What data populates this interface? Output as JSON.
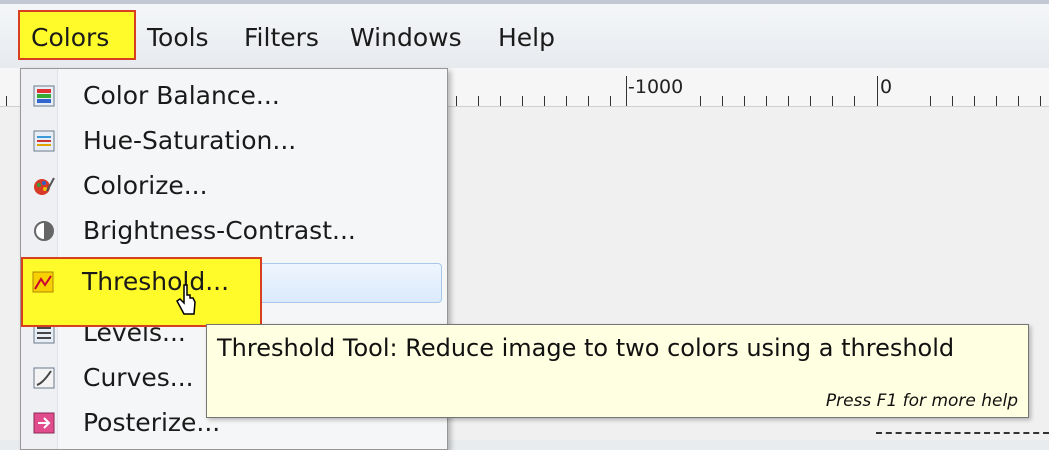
{
  "menubar": {
    "items": [
      {
        "label": "Colors"
      },
      {
        "label": "Tools"
      },
      {
        "label": "Filters"
      },
      {
        "label": "Windows"
      },
      {
        "label": "Help"
      }
    ]
  },
  "ruler": {
    "labels": [
      "-1000",
      "0"
    ]
  },
  "menu": {
    "items": [
      {
        "label": "Color Balance...",
        "icon": "color-balance-icon"
      },
      {
        "label": "Hue-Saturation...",
        "icon": "hue-saturation-icon"
      },
      {
        "label": "Colorize...",
        "icon": "colorize-icon"
      },
      {
        "label": "Brightness-Contrast...",
        "icon": "brightness-contrast-icon"
      },
      {
        "label": "Threshold...",
        "icon": "threshold-icon",
        "highlighted": true
      },
      {
        "label": "Levels...",
        "icon": "levels-icon"
      },
      {
        "label": "Curves...",
        "icon": "curves-icon"
      },
      {
        "label": "Posterize...",
        "icon": "posterize-icon"
      }
    ]
  },
  "tooltip": {
    "title": "Threshold Tool: Reduce image to two colors using a threshold",
    "hint": "Press F1 for more help"
  },
  "colors": {
    "highlight": "#fffb2b",
    "highlight_border": "#d83f1f",
    "tooltip_bg": "#ffffe1",
    "selection": "#dbeafb"
  }
}
